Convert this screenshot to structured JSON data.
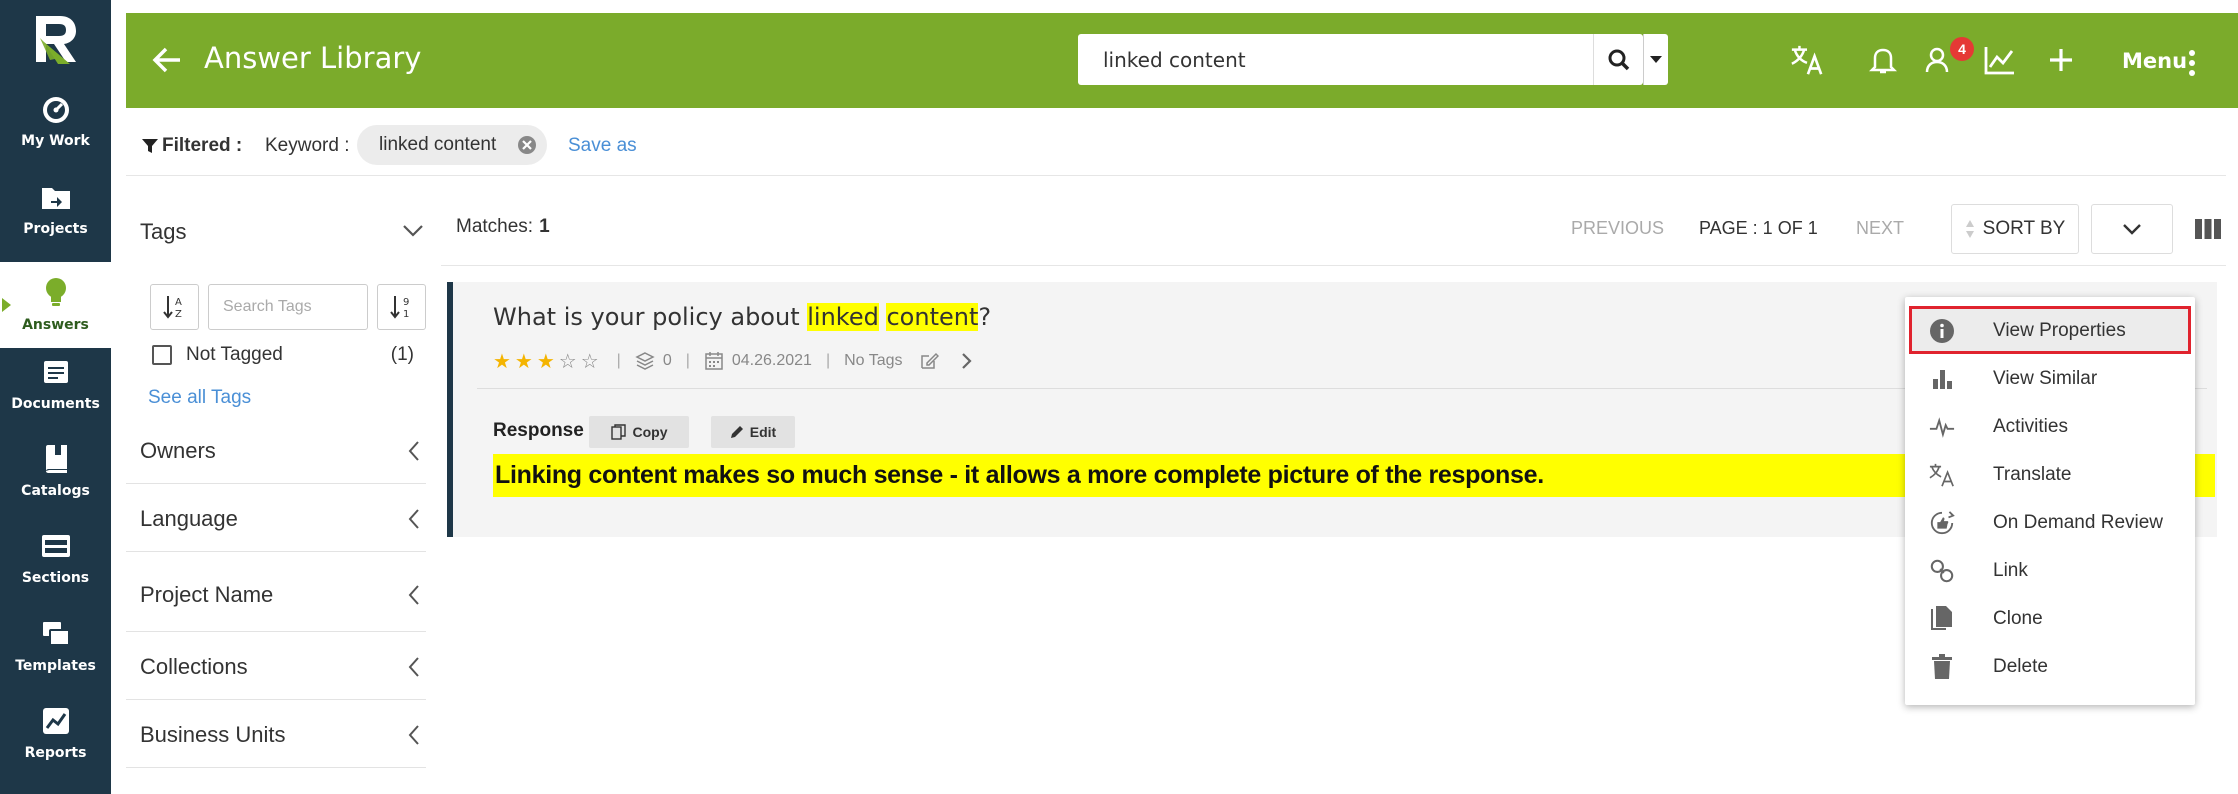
{
  "nav": {
    "items": [
      {
        "label": "My Work",
        "icon": "gauge-icon"
      },
      {
        "label": "Projects",
        "icon": "folder-icon"
      },
      {
        "label": "Answers",
        "icon": "lightbulb-icon"
      },
      {
        "label": "Documents",
        "icon": "document-icon"
      },
      {
        "label": "Catalogs",
        "icon": "book-icon"
      },
      {
        "label": "Sections",
        "icon": "sections-icon"
      },
      {
        "label": "Templates",
        "icon": "templates-icon"
      },
      {
        "label": "Reports",
        "icon": "reports-icon"
      }
    ],
    "active": "Answers"
  },
  "header": {
    "title": "Answer Library",
    "search_value": "linked content",
    "notification_badge": "4",
    "menu_label": "Menu"
  },
  "filter": {
    "filtered_label": "Filtered :",
    "keyword_label": "Keyword :",
    "keyword_chip": "linked content",
    "save_as": "Save as"
  },
  "tags": {
    "title": "Tags",
    "search_placeholder": "Search Tags",
    "not_tagged_label": "Not Tagged",
    "not_tagged_count": "(1)",
    "see_all": "See all Tags"
  },
  "facets": [
    "Owners",
    "Language",
    "Project Name",
    "Collections",
    "Business Units"
  ],
  "results": {
    "matches_label": "Matches:",
    "matches_count": "1",
    "previous": "PREVIOUS",
    "page_info": "PAGE : 1 OF 1",
    "next": "NEXT",
    "sort_by": "SORT BY"
  },
  "answer": {
    "question_pre": "What is your policy about ",
    "question_hl1": "linked",
    "question_sp": " ",
    "question_hl2": "content",
    "question_post": "?",
    "rating": 3,
    "rating_max": 5,
    "layers_count": "0",
    "date": "04.26.2021",
    "tags_text": "No Tags",
    "response_label": "Response",
    "copy_label": "Copy",
    "edit_label": "Edit",
    "response_text": "Linking content makes so much sense - it allows a more complete picture of the response."
  },
  "context_menu": {
    "items": [
      {
        "label": "View Properties",
        "icon": "info-icon"
      },
      {
        "label": "View Similar",
        "icon": "bar-chart-icon"
      },
      {
        "label": "Activities",
        "icon": "pulse-icon"
      },
      {
        "label": "Translate",
        "icon": "translate-icon"
      },
      {
        "label": "On Demand Review",
        "icon": "review-icon"
      },
      {
        "label": "Link",
        "icon": "link-icon"
      },
      {
        "label": "Clone",
        "icon": "clone-icon"
      },
      {
        "label": "Delete",
        "icon": "trash-icon"
      }
    ],
    "selected": "View Properties"
  },
  "colors": {
    "nav_bg": "#1e3748",
    "header_green": "#7bab2b",
    "highlight": "#ffff00",
    "link_blue": "#4a8fd6",
    "selected_outline": "#e0232e",
    "badge_red": "#e53935"
  }
}
